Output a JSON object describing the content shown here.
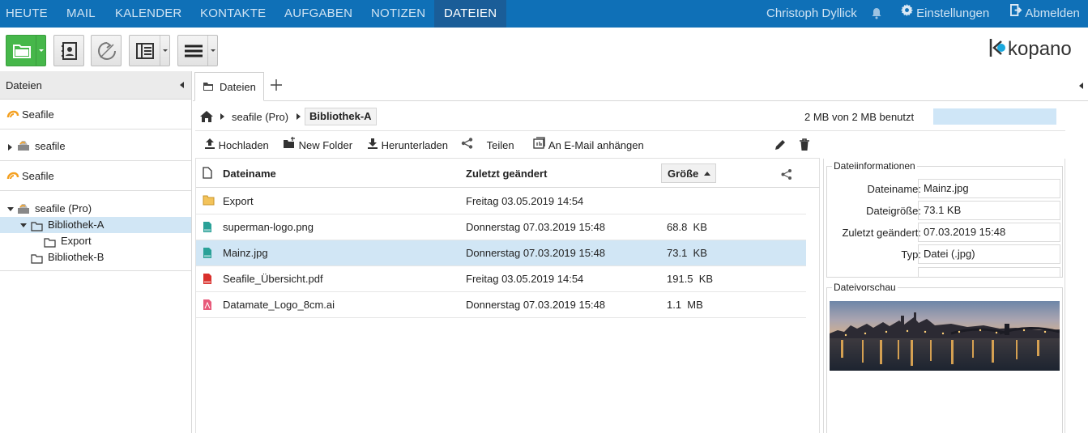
{
  "nav": {
    "tabs": [
      "HEUTE",
      "MAIL",
      "KALENDER",
      "KONTAKTE",
      "AUFGABEN",
      "NOTIZEN",
      "DATEIEN"
    ],
    "active": "DATEIEN",
    "user": "Christoph Dyllick",
    "settings": "Einstellungen",
    "logout": "Abmelden"
  },
  "brand": "kopano",
  "left": {
    "header": "Dateien",
    "accounts": [
      "Seafile",
      "seafile",
      "Seafile"
    ],
    "tree": {
      "root": "seafile (Pro)",
      "items": [
        "Bibliothek-A",
        "Export",
        "Bibliothek-B"
      ]
    }
  },
  "tabs": {
    "files_tab": "Dateien"
  },
  "breadcrumb": {
    "root": "seafile (Pro)",
    "current": "Bibliothek-A",
    "quota": "2 MB von 2 MB benutzt"
  },
  "actions": {
    "upload": "Hochladen",
    "new_folder": "New Folder",
    "download": "Herunterladen",
    "share": "Teilen",
    "attach": "An E-Mail anhängen"
  },
  "grid": {
    "columns": {
      "name": "Dateiname",
      "modified": "Zuletzt geändert",
      "size": "Größe"
    },
    "rows": [
      {
        "icon": "folder-icon",
        "name": "Export",
        "modified": "Freitag 03.05.2019 14:54",
        "size": ""
      },
      {
        "icon": "png-file-icon",
        "name": "superman-logo.png",
        "modified": "Donnerstag 07.03.2019 15:48",
        "size": "68.8  KB"
      },
      {
        "icon": "jpg-file-icon",
        "name": "Mainz.jpg",
        "modified": "Donnerstag 07.03.2019 15:48",
        "size": "73.1  KB"
      },
      {
        "icon": "pdf-file-icon",
        "name": "Seafile_Übersicht.pdf",
        "modified": "Freitag 03.05.2019 14:54",
        "size": "191.5  KB"
      },
      {
        "icon": "ai-file-icon",
        "name": "Datamate_Logo_8cm.ai",
        "modified": "Donnerstag 07.03.2019 15:48",
        "size": "1.1  MB"
      }
    ]
  },
  "info": {
    "legend": "Dateiinformationen",
    "name_label": "Dateiname:",
    "name_value": "Mainz.jpg",
    "size_label": "Dateigröße:",
    "size_value": "73.1 KB",
    "modified_label": "Zuletzt geändert:",
    "modified_value": "07.03.2019 15:48",
    "type_label": "Typ:",
    "type_value": "Datei (.jpg)",
    "preview_legend": "Dateivorschau"
  },
  "colors": {
    "nav": "#0f70b7",
    "nav_active": "#1a5d98",
    "selection": "#d1e6f5",
    "green": "#46b74a"
  }
}
